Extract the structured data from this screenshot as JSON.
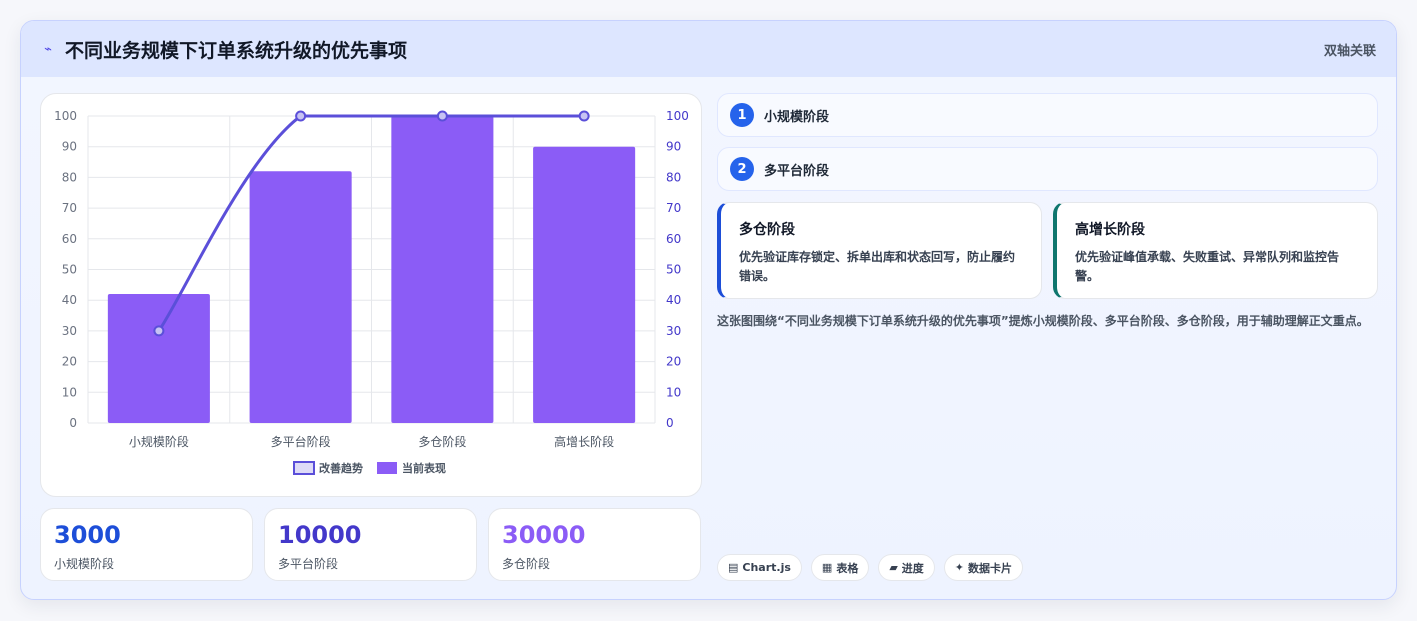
{
  "header": {
    "title": "不同业务规模下订单系统升级的优先事项",
    "title_icon": "⌁",
    "tag": "双轴关联"
  },
  "chart_data": {
    "type": "bar",
    "categories": [
      "小规模阶段",
      "多平台阶段",
      "多仓阶段",
      "高增长阶段"
    ],
    "series": [
      {
        "name": "当前表现",
        "type": "bar",
        "axis": "left",
        "values": [
          42,
          82,
          100,
          90
        ],
        "color": "#8b5cf6"
      },
      {
        "name": "改善趋势",
        "type": "line",
        "axis": "right",
        "values": [
          30,
          100,
          100,
          100
        ],
        "color": "#5b4fd9"
      }
    ],
    "y_left": {
      "min": 0,
      "max": 100,
      "ticks": [
        "0",
        "10",
        "20",
        "30",
        "40",
        "50",
        "60",
        "70",
        "80",
        "90",
        "100"
      ]
    },
    "y_right": {
      "min": 0,
      "max": 100,
      "ticks": [
        "0",
        "10",
        "20",
        "30",
        "40",
        "50",
        "60",
        "70",
        "80",
        "90",
        "100"
      ]
    },
    "legend": [
      "改善趋势",
      "当前表现"
    ],
    "legend_position": "bottom",
    "grid": true
  },
  "stats": [
    {
      "value": "3000",
      "label": "小规模阶段",
      "color": "#1d4ed8"
    },
    {
      "value": "10000",
      "label": "多平台阶段",
      "color": "#4338ca"
    },
    {
      "value": "30000",
      "label": "多仓阶段",
      "color": "#8b5cf6"
    }
  ],
  "steps": [
    {
      "num": "1",
      "label": "小规模阶段"
    },
    {
      "num": "2",
      "label": "多平台阶段"
    }
  ],
  "cards": [
    {
      "title": "多仓阶段",
      "desc": "优先验证库存锁定、拆单出库和状态回写，防止履约错误。",
      "accent": "#1d4ed8"
    },
    {
      "title": "高增长阶段",
      "desc": "优先验证峰值承载、失败重试、异常队列和监控告警。",
      "accent": "#0f766e"
    }
  ],
  "summary": "这张图围绕“不同业务规模下订单系统升级的优先事项”提炼小规模阶段、多平台阶段、多仓阶段，用于辅助理解正文重点。",
  "pills": [
    {
      "icon": "▤",
      "label": "Chart.js"
    },
    {
      "icon": "▦",
      "label": "表格"
    },
    {
      "icon": "▰",
      "label": "进度"
    },
    {
      "icon": "✦",
      "label": "数据卡片"
    }
  ]
}
